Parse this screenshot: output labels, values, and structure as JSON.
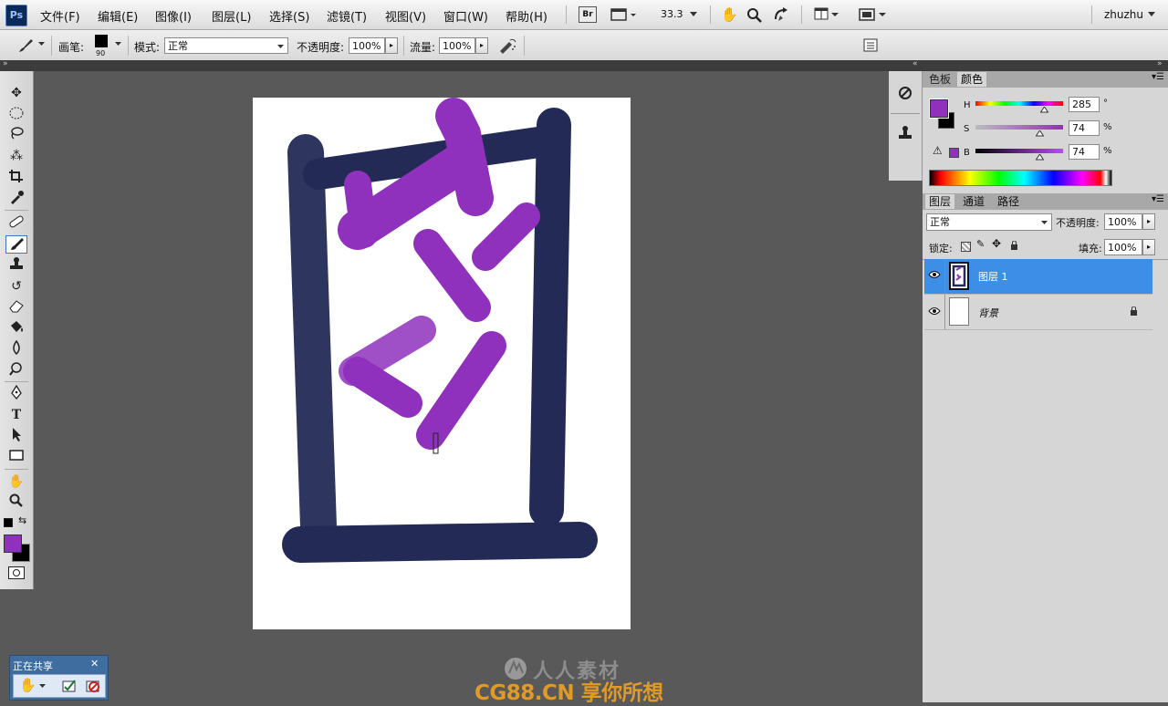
{
  "app": {
    "logo": "Ps"
  },
  "menu": [
    "文件(F)",
    "编辑(E)",
    "图像(I)",
    "图层(L)",
    "选择(S)",
    "滤镜(T)",
    "视图(V)",
    "窗口(W)",
    "帮助(H)"
  ],
  "toolbar": {
    "bridge_label": "Br",
    "zoom": "33.3",
    "user": "zhuzhu"
  },
  "options": {
    "brush_label": "画笔:",
    "brush_size": "90",
    "mode_label": "模式:",
    "mode_value": "正常",
    "opacity_label": "不透明度:",
    "opacity_value": "100%",
    "flow_label": "流量:",
    "flow_value": "100%"
  },
  "color_panel": {
    "tabs": [
      "色板",
      "颜色"
    ],
    "active_tab": "颜色",
    "h_label": "H",
    "h_value": "285",
    "h_unit": "°",
    "s_label": "S",
    "s_value": "74",
    "s_unit": "%",
    "b_label": "B",
    "b_value": "74",
    "b_unit": "%",
    "foreground": "#8f31bc",
    "background": "#000000"
  },
  "layers_panel": {
    "tabs": [
      "图层",
      "通道",
      "路径"
    ],
    "active_tab": "图层",
    "blend_mode": "正常",
    "opacity_label": "不透明度:",
    "opacity_value": "100%",
    "lock_label": "锁定:",
    "fill_label": "填充:",
    "fill_value": "100%",
    "layers": [
      {
        "name": "图层 1",
        "selected": true
      },
      {
        "name": "背景",
        "selected": false
      }
    ]
  },
  "share": {
    "title": "正在共享",
    "close": "✕"
  },
  "watermark": {
    "line1": "人人素材",
    "line2": "CG88.CN 享你所想"
  },
  "colors": {
    "accent_selected": "#3d8ee6",
    "navy_paint": "#232a55",
    "purple_paint": "#8f31bc"
  },
  "icons": [
    "brush-icon",
    "move-icon",
    "marquee-icon",
    "lasso-icon",
    "magic-wand-icon",
    "crop-icon",
    "eyedropper-icon",
    "healing-icon",
    "brush-tool-icon",
    "stamp-icon",
    "history-brush-icon",
    "eraser-icon",
    "bucket-icon",
    "blur-icon",
    "dodge-icon",
    "pen-icon",
    "type-icon",
    "path-select-icon",
    "shape-icon",
    "hand-icon",
    "zoom-icon",
    "eye-icon",
    "lock-icon"
  ]
}
